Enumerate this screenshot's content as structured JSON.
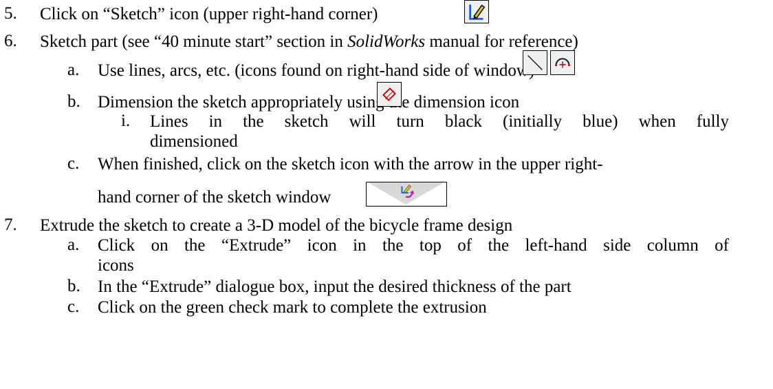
{
  "items": [
    {
      "marker": "5.",
      "text": "Click on “Sketch” icon (upper right-hand corner)"
    },
    {
      "marker": "6.",
      "text_before": "Sketch part (see “40 minute start” section in ",
      "text_em": "SolidWorks",
      "text_after": " manual for reference)"
    },
    {
      "marker": "a.",
      "text": "Use lines, arcs, etc. (icons found on right-hand side of window)"
    },
    {
      "marker": "b.",
      "text": "Dimension the sketch appropriately using the dimension icon"
    },
    {
      "marker": "i.",
      "line1": "Lines in the sketch will turn black (initially blue) when fully",
      "line2": "dimensioned"
    },
    {
      "marker": "c.",
      "line1": "When finished, click on the sketch icon with the arrow in the upper right-",
      "line2": "hand corner of the sketch window"
    },
    {
      "marker": "7.",
      "text": "Extrude the sketch to create a 3-D model of the bicycle frame design"
    },
    {
      "marker": "a.",
      "line1": "Click on the “Extrude” icon in the top of the left-hand side column of",
      "line2": "icons"
    },
    {
      "marker": "b.",
      "text": "In the “Extrude” dialogue box, input the desired thickness of the part"
    },
    {
      "marker": "c.",
      "text": "Click on the green check mark to complete the extrusion"
    }
  ],
  "icons": [
    "sketch-icon",
    "line-icon",
    "arc-icon",
    "dimension-icon",
    "exit-sketch-icon"
  ]
}
